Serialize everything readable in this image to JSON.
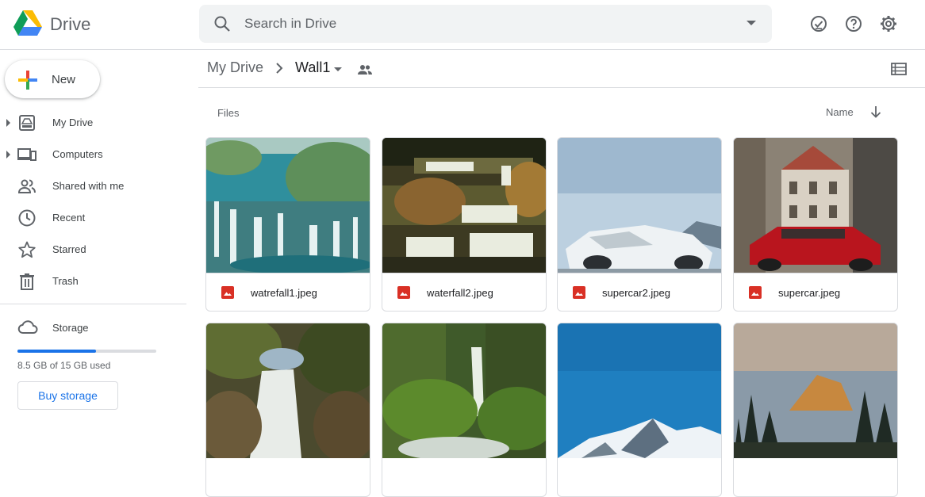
{
  "app": {
    "title": "Drive"
  },
  "search": {
    "placeholder": "Search in Drive"
  },
  "header_icons": [
    "offline-status-icon",
    "help-icon",
    "settings-icon"
  ],
  "sidebar": {
    "new_label": "New",
    "items": [
      {
        "label": "My Drive",
        "icon": "my-drive-icon",
        "expandable": true
      },
      {
        "label": "Computers",
        "icon": "computers-icon",
        "expandable": true
      },
      {
        "label": "Shared with me",
        "icon": "shared-with-me-icon",
        "expandable": false
      },
      {
        "label": "Recent",
        "icon": "clock-icon",
        "expandable": false
      },
      {
        "label": "Starred",
        "icon": "star-icon",
        "expandable": false
      },
      {
        "label": "Trash",
        "icon": "trash-icon",
        "expandable": false
      }
    ],
    "storage": {
      "label": "Storage",
      "used_text": "8.5 GB of 15 GB used",
      "used_fraction": 0.567,
      "buy_label": "Buy storage"
    }
  },
  "breadcrumb": {
    "root": "My Drive",
    "current": "Wall1"
  },
  "section": {
    "files_label": "Files",
    "sort_label": "Name"
  },
  "files": [
    {
      "name": "watrefall1.jpeg"
    },
    {
      "name": "waterfall2.jpeg"
    },
    {
      "name": "supercar2.jpeg"
    },
    {
      "name": "supercar.jpeg"
    },
    {
      "name": ""
    },
    {
      "name": ""
    },
    {
      "name": ""
    },
    {
      "name": ""
    }
  ],
  "colors": {
    "accent": "#1a73e8",
    "image_file_icon": "#d93025",
    "divider": "#dadce0",
    "search_bg": "#f1f3f4"
  }
}
